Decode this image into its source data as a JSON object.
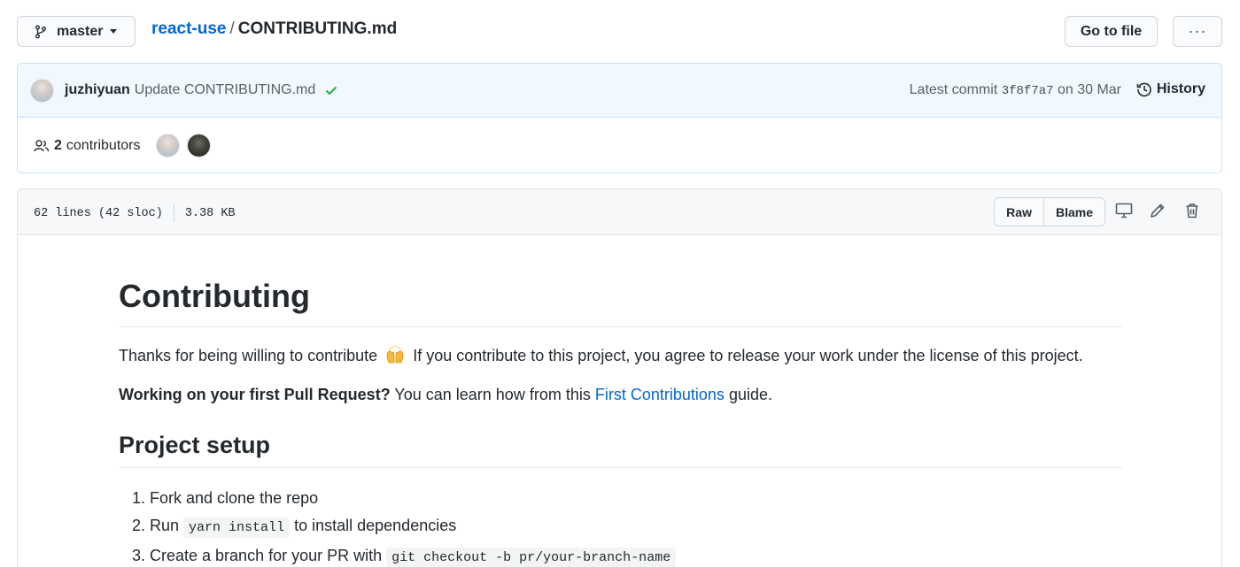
{
  "header": {
    "branch": "master",
    "repo": "react-use",
    "separator": "/",
    "file": "CONTRIBUTING.md",
    "goto_label": "Go to file",
    "more_label": "···"
  },
  "commit": {
    "author": "juzhiyuan",
    "message": "Update CONTRIBUTING.md",
    "latest_prefix": "Latest commit",
    "sha": "3f8f7a7",
    "date": "on 30 Mar",
    "history_label": "History"
  },
  "contributors": {
    "count": "2",
    "label": "contributors"
  },
  "fileinfo": {
    "lines": "62 lines (42 sloc)",
    "size": "3.38 KB",
    "raw_label": "Raw",
    "blame_label": "Blame"
  },
  "content": {
    "h1": "Contributing",
    "p1_before": "Thanks for being willing to contribute",
    "p1_after": "If you contribute to this project, you agree to release your work under the license of this project.",
    "p2_strong": "Working on your first Pull Request?",
    "p2_middle": "You can learn how from this",
    "p2_link": "First Contributions",
    "p2_end": "guide.",
    "h2": "Project setup",
    "steps": [
      {
        "before": "Fork and clone the repo",
        "code": "",
        "after": ""
      },
      {
        "before": "Run",
        "code": "yarn install",
        "after": "to install dependencies"
      },
      {
        "before": "Create a branch for your PR with",
        "code": "git checkout -b pr/your-branch-name",
        "after": ""
      }
    ]
  },
  "colors": {
    "link": "#0366d6",
    "commit_bg": "#f1f8ff",
    "check": "#28a745"
  }
}
